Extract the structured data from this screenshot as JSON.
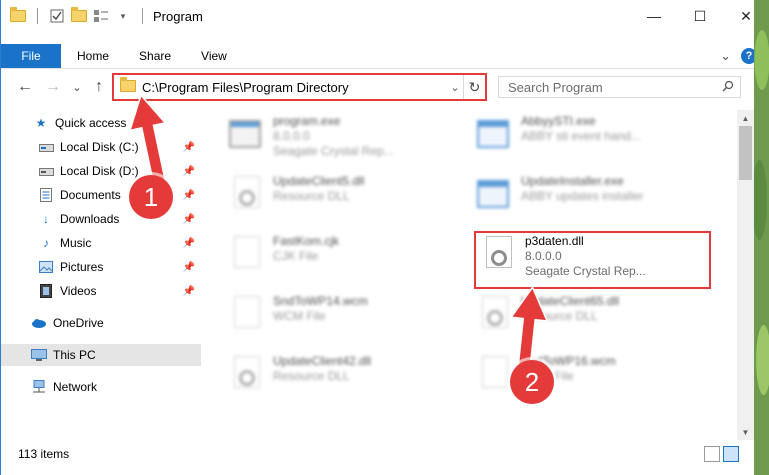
{
  "window": {
    "title": "Program",
    "controls": {
      "minimize": "—",
      "maximize": "☐",
      "close": "✕"
    }
  },
  "ribbon": {
    "tabs": [
      {
        "label": "File"
      },
      {
        "label": "Home"
      },
      {
        "label": "Share"
      },
      {
        "label": "View"
      }
    ],
    "expand_glyph": "⌄",
    "help_glyph": "?"
  },
  "nav": {
    "back": "←",
    "forward": "→",
    "recent": "⌄",
    "up": "↑",
    "address": "C:\\Program Files\\Program Directory",
    "refresh": "↻",
    "search_placeholder": "Search Program",
    "search_icon": "search-icon"
  },
  "sidebar": {
    "items": [
      {
        "label": "Quick access",
        "icon": "star-icon",
        "pinned": false
      },
      {
        "label": "Local Disk (C:)",
        "icon": "drive-icon",
        "pinned": true
      },
      {
        "label": "Local Disk (D:)",
        "icon": "drive-icon",
        "pinned": true
      },
      {
        "label": "Documents",
        "icon": "documents-icon",
        "pinned": true
      },
      {
        "label": "Downloads",
        "icon": "downloads-icon",
        "pinned": true
      },
      {
        "label": "Music",
        "icon": "music-icon",
        "pinned": true
      },
      {
        "label": "Pictures",
        "icon": "pictures-icon",
        "pinned": true
      },
      {
        "label": "Videos",
        "icon": "videos-icon",
        "pinned": true
      },
      {
        "label": "OneDrive",
        "icon": "cloud-icon",
        "pinned": false
      },
      {
        "label": "This PC",
        "icon": "pc-icon",
        "pinned": false,
        "selected": true
      },
      {
        "label": "Network",
        "icon": "network-icon",
        "pinned": false
      }
    ]
  },
  "files": [
    {
      "name": "program.exe",
      "line2": "8.0.0.0",
      "line3": "Seagate Crystal Rep...",
      "icon": "exe-icon",
      "blurred": true
    },
    {
      "name": "AbbyySTI.exe",
      "line2": "ABBY sti event hand...",
      "line3": "",
      "icon": "exe-icon",
      "blurred": true
    },
    {
      "name": "UpdateClient5.dll",
      "line2": "Resource DLL",
      "line3": "",
      "icon": "dll-icon",
      "blurred": true
    },
    {
      "name": "UpdateInstaller.exe",
      "line2": "ABBY updates installer",
      "line3": "",
      "icon": "exe-icon",
      "blurred": true
    },
    {
      "name": "FastKom.cjk",
      "line2": "CJK File",
      "line3": "",
      "icon": "file-icon",
      "blurred": true
    },
    {
      "name": "p3daten.dll",
      "line2": "8.0.0.0",
      "line3": "Seagate Crystal Rep...",
      "icon": "dll-icon",
      "blurred": false
    },
    {
      "name": "SndToWP14.wcm",
      "line2": "WCM File",
      "line3": "",
      "icon": "file-icon",
      "blurred": true
    },
    {
      "name": "UpdateClient65.dll",
      "line2": "Resource DLL",
      "line3": "",
      "icon": "dll-icon",
      "blurred": true
    },
    {
      "name": "UpdateClient42.dll",
      "line2": "Resource DLL",
      "line3": "",
      "icon": "dll-icon",
      "blurred": true
    },
    {
      "name": "SndToWP16.wcm",
      "line2": "WCM File",
      "line3": "",
      "icon": "file-icon",
      "blurred": true
    }
  ],
  "status": {
    "items_count": "113 items"
  },
  "annotations": [
    {
      "number": "1",
      "color": "#e53a3a"
    },
    {
      "number": "2",
      "color": "#e53a3a"
    }
  ],
  "colors": {
    "accent": "#1a73c8",
    "highlight": "#e53a3a",
    "selection": "#e5e5e5"
  }
}
